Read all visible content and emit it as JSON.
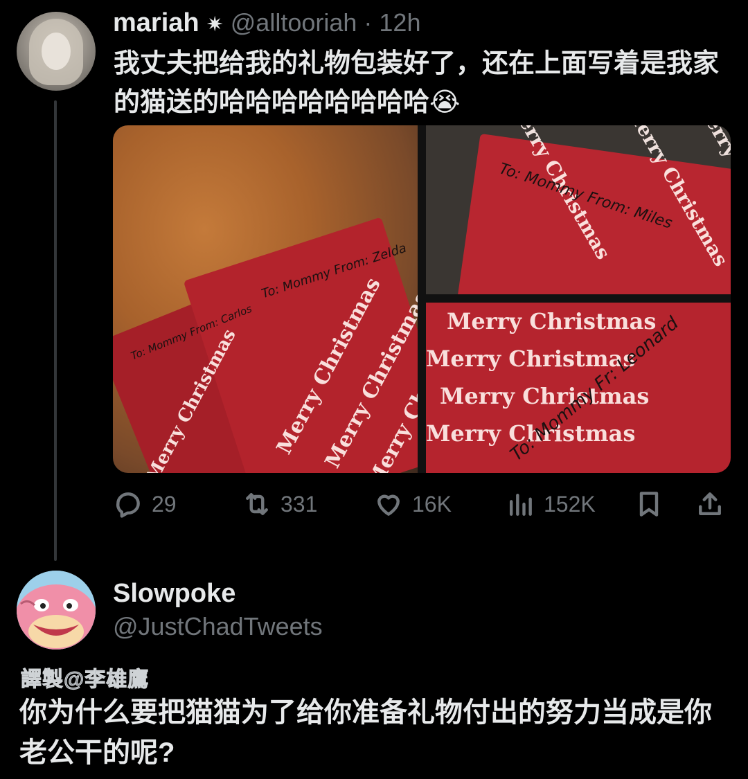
{
  "tweet": {
    "author_name": "mariah",
    "verified_glyph": "✷",
    "handle": "@alltooriah",
    "separator": "·",
    "time": "12h",
    "text": "我丈夫把给我的礼物包装好了，还在上面写着是我家的猫送的哈哈哈哈哈哈哈哈😭",
    "media": {
      "wrapping_text": "Merry Christmas",
      "tags": [
        "To: Mommy  From: Zelda",
        "To: Mommy  From: Carlos",
        "To: Mommy  From: Miles",
        "To: Mommy  Fr: Leonard"
      ]
    },
    "actions": {
      "replies": "29",
      "retweets": "331",
      "likes": "16K",
      "views": "152K"
    }
  },
  "reply": {
    "author_name": "Slowpoke",
    "handle": "@JustChadTweets",
    "watermark": "譯製@李雄鷹",
    "text": "你为什么要把猫猫为了给你准备礼物付出的努力当成是你老公干的呢?"
  },
  "icons": {
    "reply": "speech-bubble-icon",
    "retweet": "retweet-icon",
    "like": "heart-icon",
    "views": "bar-chart-icon",
    "bookmark": "bookmark-icon",
    "share": "share-icon"
  }
}
